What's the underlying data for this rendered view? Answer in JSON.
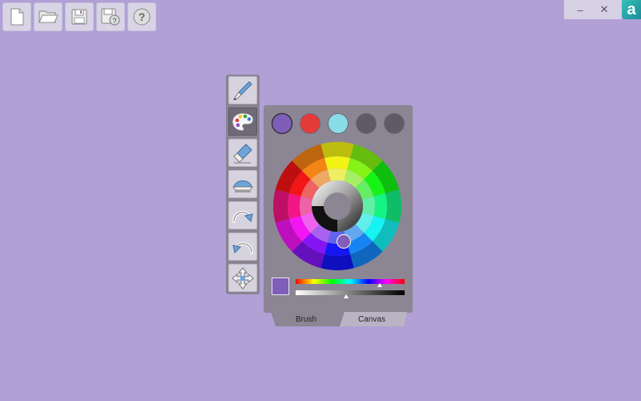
{
  "toolbar": {
    "buttons": [
      {
        "name": "new-file-button",
        "icon": "new-file-icon"
      },
      {
        "name": "open-folder-button",
        "icon": "folder-open-icon"
      },
      {
        "name": "save-button",
        "icon": "floppy-disk-icon"
      },
      {
        "name": "save-as-button",
        "icon": "save-as-icon"
      },
      {
        "name": "help-button",
        "icon": "help-icon"
      }
    ],
    "help_glyph": "?",
    "save_as_glyph": "?"
  },
  "window_controls": {
    "minimize": "–",
    "close": "✕",
    "logo_letter": "a"
  },
  "tools": [
    {
      "name": "brush-tool",
      "icon": "brush-icon",
      "active": false
    },
    {
      "name": "color-palette-tool",
      "icon": "palette-icon",
      "active": true
    },
    {
      "name": "eraser-tool",
      "icon": "eraser-icon",
      "active": false
    },
    {
      "name": "fill-tool",
      "icon": "fill-bucket-icon",
      "active": false
    },
    {
      "name": "redo-tool",
      "icon": "redo-icon",
      "active": false
    },
    {
      "name": "undo-tool",
      "icon": "undo-icon",
      "active": false
    },
    {
      "name": "move-tool",
      "icon": "move-arrows-icon",
      "active": false
    }
  ],
  "color_panel": {
    "swatches": [
      "#7f5db8",
      "#e43a3a",
      "#88dde6",
      "#5e5a66",
      "#5e5a66"
    ],
    "current_color": "#7f5db8",
    "hue_position": 0.77,
    "brightness_position": 0.46,
    "tabs": [
      {
        "label": "Brush",
        "active": true
      },
      {
        "label": "Canvas",
        "active": false
      }
    ]
  }
}
